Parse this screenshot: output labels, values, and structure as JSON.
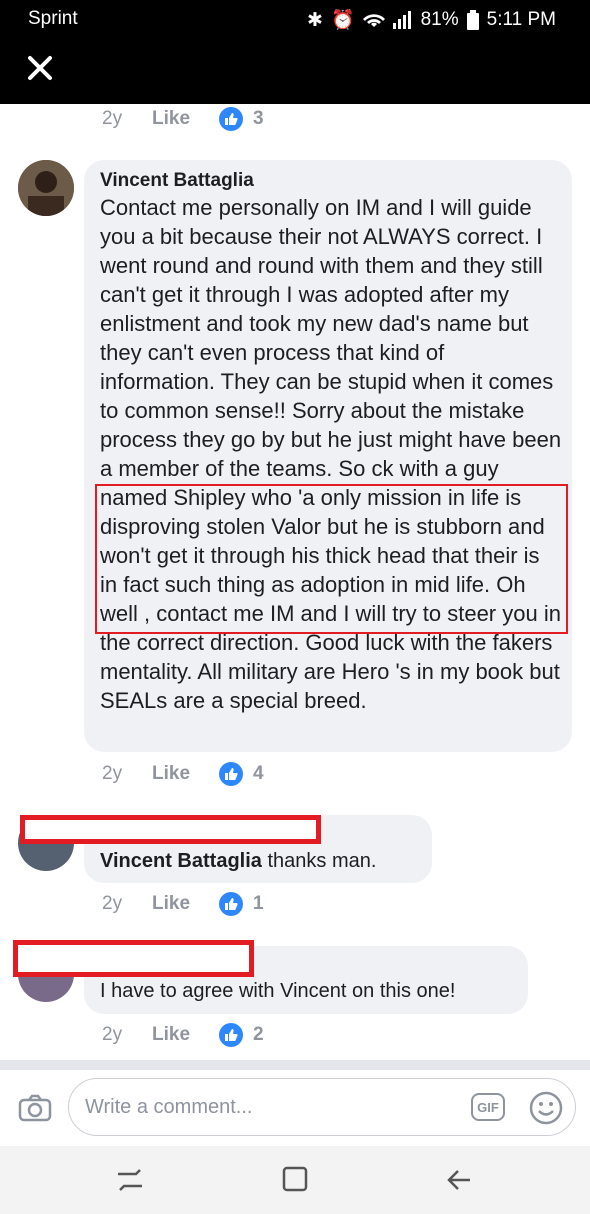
{
  "status_bar": {
    "carrier": "Sprint",
    "battery": "81%",
    "time": "5:11 PM"
  },
  "top_reply_meta": {
    "age": "2y",
    "like": "Like",
    "count": "3"
  },
  "comments": [
    {
      "author": "Vincent Battaglia",
      "text": "Contact me personally on IM and I will guide you a bit because their not ALWAYS  correct. I went round and round with them and they still can't get it through I was adopted after my enlistment and took my new dad's name but they can't even process that kind of information. They can be stupid when it comes to common sense!! Sorry about the mistake process they go by but he just might have been a member of the teams. So ck with a guy named Shipley who 'a only mission in life is disproving stolen Valor but he is stubborn and won't get it through his thick head that their is in fact such thing as adoption in mid life. Oh well , contact me IM and I will try to steer you in the correct direction. Good luck with the fakers mentality. All military are Hero 's in my book but SEALs  are a special breed.",
      "age": "2y",
      "like": "Like",
      "count": "4"
    },
    {
      "mention": "Vincent Battaglia",
      "text": " thanks man.",
      "age": "2y",
      "like": "Like",
      "count": "1"
    },
    {
      "text": "I have to agree with Vincent on this one!",
      "age": "2y",
      "like": "Like",
      "count": "2"
    }
  ],
  "composer": {
    "placeholder": "Write a comment...",
    "gif_label": "GIF"
  },
  "colors": {
    "accent": "#2d88ff",
    "highlight": "#e31b23"
  }
}
